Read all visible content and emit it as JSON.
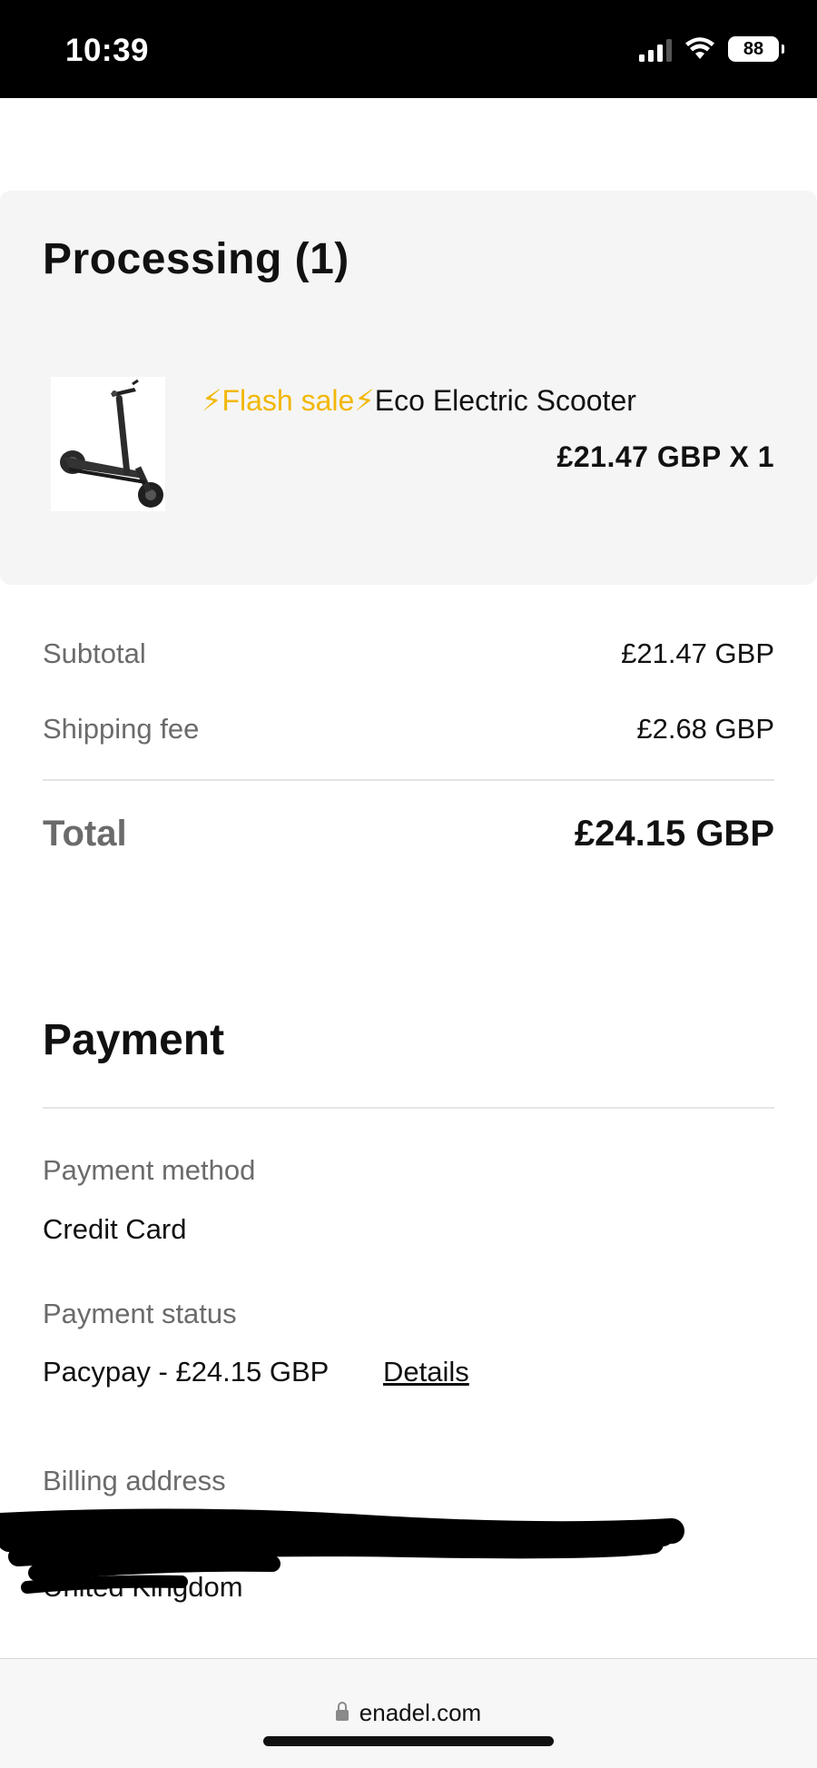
{
  "status_bar": {
    "time": "10:39",
    "battery_level": "88",
    "icons": [
      "signal-icon",
      "wifi-icon",
      "battery-icon"
    ]
  },
  "order": {
    "processing_title": "Processing (1)",
    "item": {
      "name_prefix": "⚡Flash sale⚡",
      "name_suffix": "Eco Electric Scooter",
      "price": "£21.47 GBP X 1"
    }
  },
  "summary": {
    "subtotal_label": "Subtotal",
    "subtotal_value": "£21.47 GBP",
    "shipping_label": "Shipping fee",
    "shipping_value": "£2.68 GBP",
    "total_label": "Total",
    "total_value": "£24.15 GBP"
  },
  "payment": {
    "title": "Payment",
    "method_label": "Payment method",
    "method_value": "Credit Card",
    "status_label": "Payment status",
    "status_value": "Pacypay - £24.15 GBP",
    "details_link": "Details",
    "billing_label": "Billing address",
    "billing_visible_text": "United Kingdom"
  },
  "browser": {
    "url": "enadel.com"
  },
  "colors": {
    "bolt": "#f2b705",
    "panel_bg": "#f5f5f5",
    "muted_text": "#6b6b6b"
  }
}
